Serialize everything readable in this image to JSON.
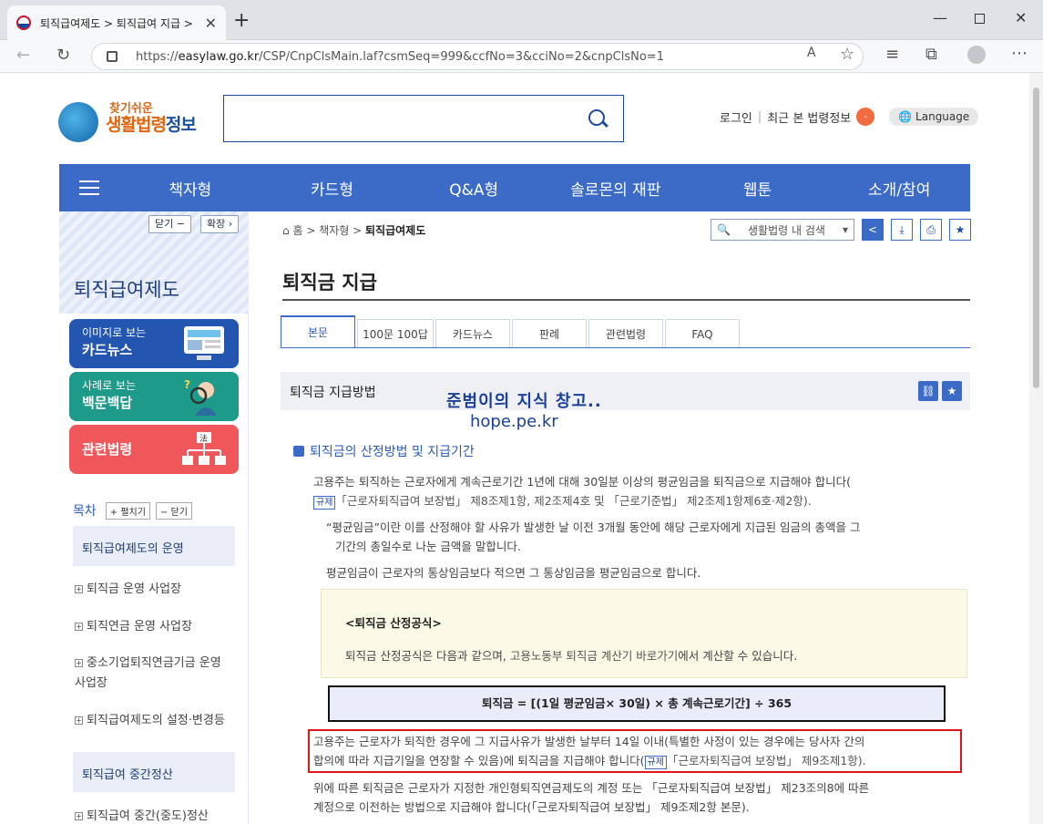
{
  "browser": {
    "tab_title": "퇴직급여제도 > 퇴직급여 지급 >",
    "url_prefix": "https://",
    "url_domain": "easylaw.go.kr",
    "url_path": "/CSP/CnpClsMain.laf?csmSeq=999&ccfNo=3&cciNo=2&cnpClsNo=1"
  },
  "header": {
    "logo_small": "찾기쉬운",
    "logo_main_a": "생활법령",
    "logo_main_b": "정보",
    "login": "로그인",
    "recent": "최근 본 법령정보",
    "recent_count": "-",
    "language": "Language"
  },
  "gnb": [
    "책자형",
    "카드형",
    "Q&A형",
    "솔로몬의 재판",
    "웹툰",
    "소개/참여"
  ],
  "lnb": {
    "collapse": "닫기 −",
    "expand": "확장 ›",
    "title": "퇴직급여제도",
    "quick": [
      {
        "line1": "이미지로 보는",
        "line2": "카드뉴스",
        "color": "#2356b0"
      },
      {
        "line1": "사례로 보는",
        "line2": "백문백답",
        "color": "#1e9a8a"
      },
      {
        "line1": "",
        "line2": "관련법령",
        "color": "#f0575a"
      }
    ],
    "toc_label": "목차",
    "toc_open": "+ 펼치기",
    "toc_close": "− 닫기",
    "sections": [
      {
        "title": "퇴직급여제도의 운영"
      },
      {
        "title": "퇴직급여 중간정산"
      }
    ],
    "items": [
      "퇴직금 운영 사업장",
      "퇴직연금 운영 사업장",
      "중소기업퇴직연금기금 운영사업장",
      "퇴직급여제도의 설정·변경등",
      "퇴직급여 중간(중도)정산"
    ]
  },
  "content": {
    "breadcrumb": {
      "home": "홈",
      "level1": "책자형",
      "current": "퇴직급여제도"
    },
    "search_placeholder": "생활법령 내 검색",
    "page_title": "퇴직금 지급",
    "tabs": [
      "본문",
      "100문 100답",
      "카드뉴스",
      "판례",
      "관련법령",
      "FAQ"
    ],
    "section_title": "퇴직금 지급방법",
    "watermark_1": "준범이의 지식 창고..",
    "watermark_2": "hope.pe.kr",
    "subsection": "퇴직금의 산정방법 및 지급기간",
    "para1_a": "고용주는 퇴직하는 근로자에게 계속근로기간 1년에 대해 30일분 이상의 평균임금을 퇴직금으로 지급해야 합니다(",
    "tag": "규제",
    "para1_b": "「근로자퇴직급여 보장법」 제8조제1항, 제2조제4호 및 「근로기준법」 제2조제1항제6호·제2항).",
    "para2_a": "“평균임금”이란 이를 산정해야 할 사유가 발생한 날 이전 3개월 동안에 해당 근로자에게 지급된 임금의 총액을 그",
    "para2_b": "기간의 총일수로 나눈 금액을 말합니다.",
    "para3": "평균임금이 근로자의 통상임금보다 적으면 그 통상임금을 평균임금으로 합니다.",
    "note_title": "<퇴직금 산정공식>",
    "note_body_a": "퇴직금 산정공식은 다음과 같으며, ",
    "note_body_link": "고용노동부 퇴직금 계산기 바로가기",
    "note_body_b": "에서 계산할 수 있습니다.",
    "formula": "퇴직금 = [(1일 평균임금× 30일) × 총 계속근로기간] ÷ 365",
    "para4_a": "고용주는 근로자가 퇴직한 경우에 그 지급사유가 발생한 날부터 14일 이내(특별한 사정이 있는 경우에는 당사자 간의",
    "para4_b": "합의에 따라 지급기일을 연장할 수 있음)에 퇴직금을 지급해야 합니다(",
    "para4_c": "「근로자퇴직급여 보장법」 제9조제1항).",
    "para5_a": "위에 따른 퇴직금은 근로자가 지정한 개인형퇴직연금제도의 계정 또는 「근로자퇴직급여 보장법」 제23조의8에 따른",
    "para5_b": "계정으로 이전하는 방법으로 지급해야 합니다(「근로자퇴직급여 보장법」 제9조제2항 본문)."
  }
}
